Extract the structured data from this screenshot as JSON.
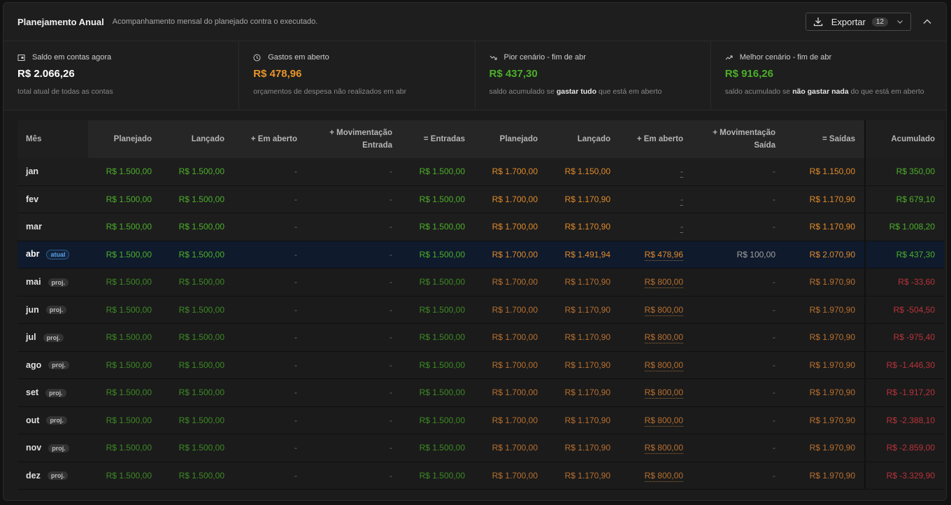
{
  "header": {
    "title": "Planejamento Anual",
    "subtitle": "Acompanhamento mensal do planejado contra o executado.",
    "export_label": "Exportar",
    "export_count": "12"
  },
  "cards": [
    {
      "label": "Saldo em contas agora",
      "icon": "wallet-icon",
      "value": "R$ 2.066,26",
      "color": "#ffffff",
      "desc_pre": "total atual de todas as contas",
      "desc_bold": "",
      "desc_post": ""
    },
    {
      "label": "Gastos em aberto",
      "icon": "clock-icon",
      "value": "R$ 478,96",
      "color": "#e8952a",
      "desc_pre": "orçamentos de despesa não realizados em abr",
      "desc_bold": "",
      "desc_post": ""
    },
    {
      "label": "Pior cenário - fim de abr",
      "icon": "trend-down-icon",
      "value": "R$ 437,30",
      "color": "#4caf2a",
      "desc_pre": "saldo acumulado se ",
      "desc_bold": "gastar tudo",
      "desc_post": " que está em aberto"
    },
    {
      "label": "Melhor cenário - fim de abr",
      "icon": "trend-up-icon",
      "value": "R$ 916,26",
      "color": "#4caf2a",
      "desc_pre": "saldo acumulado se ",
      "desc_bold": "não gastar nada",
      "desc_post": " do que está em aberto"
    }
  ],
  "table": {
    "headers": [
      "Mês",
      "Planejado",
      "Lançado",
      "+ Em aberto",
      "+ Movimentação Entrada",
      "= Entradas",
      "Planejado",
      "Lançado",
      "+ Em aberto",
      "+ Movimentação Saída",
      "= Saídas",
      "Acumulado"
    ],
    "rows": [
      {
        "mes": "jan",
        "tag": "",
        "type": "row",
        "v": [
          "R$ 1.500,00",
          "R$ 1.500,00",
          "-",
          "-",
          "R$ 1.500,00",
          "R$ 1.700,00",
          "R$ 1.150,00",
          "-",
          "-",
          "R$ 1.150,00",
          "R$ 350,00"
        ],
        "acc_color": "g"
      },
      {
        "mes": "fev",
        "tag": "",
        "type": "row",
        "v": [
          "R$ 1.500,00",
          "R$ 1.500,00",
          "-",
          "-",
          "R$ 1.500,00",
          "R$ 1.700,00",
          "R$ 1.170,90",
          "-",
          "-",
          "R$ 1.170,90",
          "R$ 679,10"
        ],
        "acc_color": "g"
      },
      {
        "mes": "mar",
        "tag": "",
        "type": "row",
        "v": [
          "R$ 1.500,00",
          "R$ 1.500,00",
          "-",
          "-",
          "R$ 1.500,00",
          "R$ 1.700,00",
          "R$ 1.170,90",
          "-",
          "-",
          "R$ 1.170,90",
          "R$ 1.008,20"
        ],
        "acc_color": "g"
      },
      {
        "mes": "abr",
        "tag": "atual",
        "type": "cur",
        "v": [
          "R$ 1.500,00",
          "R$ 1.500,00",
          "-",
          "-",
          "R$ 1.500,00",
          "R$ 1.700,00",
          "R$ 1.491,94",
          "R$ 478,96",
          "R$ 100,00",
          "R$ 2.070,90",
          "R$ 437,30"
        ],
        "acc_color": "g"
      },
      {
        "mes": "mai",
        "tag": "proj.",
        "type": "proj",
        "v": [
          "R$ 1.500,00",
          "R$ 1.500,00",
          "-",
          "-",
          "R$ 1.500,00",
          "R$ 1.700,00",
          "R$ 1.170,90",
          "R$ 800,00",
          "-",
          "R$ 1.970,90",
          "R$ -33,60"
        ],
        "acc_color": "r"
      },
      {
        "mes": "jun",
        "tag": "proj.",
        "type": "proj",
        "v": [
          "R$ 1.500,00",
          "R$ 1.500,00",
          "-",
          "-",
          "R$ 1.500,00",
          "R$ 1.700,00",
          "R$ 1.170,90",
          "R$ 800,00",
          "-",
          "R$ 1.970,90",
          "R$ -504,50"
        ],
        "acc_color": "r"
      },
      {
        "mes": "jul",
        "tag": "proj.",
        "type": "proj",
        "v": [
          "R$ 1.500,00",
          "R$ 1.500,00",
          "-",
          "-",
          "R$ 1.500,00",
          "R$ 1.700,00",
          "R$ 1.170,90",
          "R$ 800,00",
          "-",
          "R$ 1.970,90",
          "R$ -975,40"
        ],
        "acc_color": "r"
      },
      {
        "mes": "ago",
        "tag": "proj.",
        "type": "proj",
        "v": [
          "R$ 1.500,00",
          "R$ 1.500,00",
          "-",
          "-",
          "R$ 1.500,00",
          "R$ 1.700,00",
          "R$ 1.170,90",
          "R$ 800,00",
          "-",
          "R$ 1.970,90",
          "R$ -1.446,30"
        ],
        "acc_color": "r"
      },
      {
        "mes": "set",
        "tag": "proj.",
        "type": "proj",
        "v": [
          "R$ 1.500,00",
          "R$ 1.500,00",
          "-",
          "-",
          "R$ 1.500,00",
          "R$ 1.700,00",
          "R$ 1.170,90",
          "R$ 800,00",
          "-",
          "R$ 1.970,90",
          "R$ -1.917,20"
        ],
        "acc_color": "r"
      },
      {
        "mes": "out",
        "tag": "proj.",
        "type": "proj",
        "v": [
          "R$ 1.500,00",
          "R$ 1.500,00",
          "-",
          "-",
          "R$ 1.500,00",
          "R$ 1.700,00",
          "R$ 1.170,90",
          "R$ 800,00",
          "-",
          "R$ 1.970,90",
          "R$ -2.388,10"
        ],
        "acc_color": "r"
      },
      {
        "mes": "nov",
        "tag": "proj.",
        "type": "proj",
        "v": [
          "R$ 1.500,00",
          "R$ 1.500,00",
          "-",
          "-",
          "R$ 1.500,00",
          "R$ 1.700,00",
          "R$ 1.170,90",
          "R$ 800,00",
          "-",
          "R$ 1.970,90",
          "R$ -2.859,00"
        ],
        "acc_color": "r"
      },
      {
        "mes": "dez",
        "tag": "proj.",
        "type": "proj",
        "v": [
          "R$ 1.500,00",
          "R$ 1.500,00",
          "-",
          "-",
          "R$ 1.500,00",
          "R$ 1.700,00",
          "R$ 1.170,90",
          "R$ 800,00",
          "-",
          "R$ 1.970,90",
          "R$ -3.329,90"
        ],
        "acc_color": "r"
      }
    ]
  },
  "colors": {
    "green": "#4caf2a",
    "orange": "#e08a2a",
    "red": "#d0383a",
    "current_row": "#0f1a2c"
  }
}
